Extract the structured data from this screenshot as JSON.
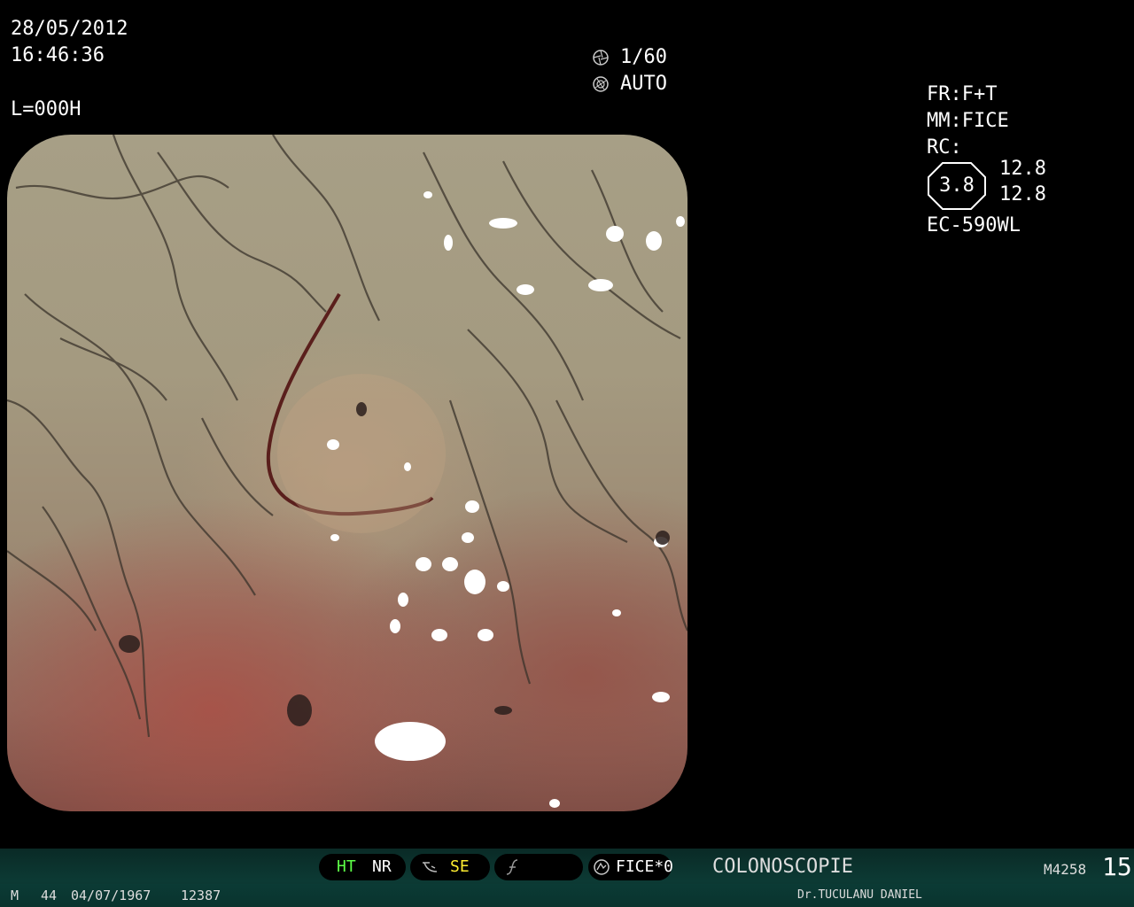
{
  "overlay": {
    "date": "28/05/2012",
    "time": "16:46:36",
    "level": "L=000H"
  },
  "shutter": {
    "speed": "1/60",
    "mode": "AUTO",
    "speed_icon": "shutter-speed-icon",
    "mode_icon": "aperture-icon"
  },
  "params": {
    "fr": "FR:F+T",
    "mm": "MM:FICE",
    "rc": "RC:",
    "rc_value": "3.8",
    "rc_a": "12.8",
    "rc_b": "12.8",
    "scope_model": "EC-590WL"
  },
  "bar": {
    "ht": "HT",
    "nr": "NR",
    "se": "SE",
    "fice": "FICE*0",
    "procedure": "COLONOSCOPIE",
    "code": "M4258",
    "number": "15",
    "colors": {
      "ht": "#5dff47",
      "se": "#ffee30"
    }
  },
  "patient": {
    "sex": "M",
    "age": "44",
    "dob": "04/07/1967",
    "id": "12387",
    "doctor": "Dr.TUCULANU DANIEL"
  }
}
